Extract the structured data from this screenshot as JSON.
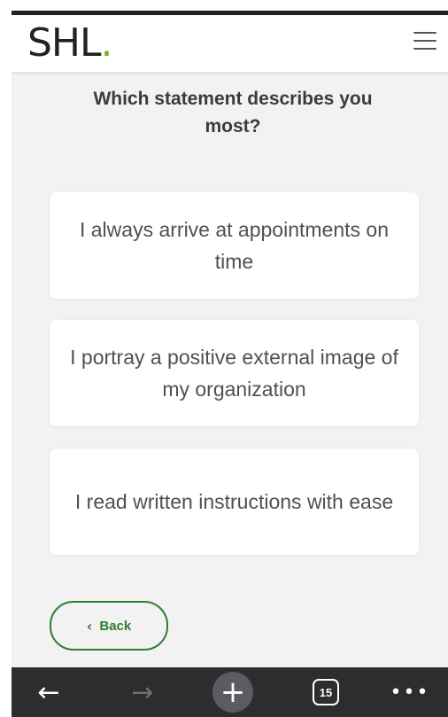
{
  "header": {
    "logo_text": "SHL",
    "logo_dot": ".",
    "menu_icon": "hamburger-menu-icon"
  },
  "question": "Which statement describes you most?",
  "options": [
    {
      "label": "I always arrive at appointments on time"
    },
    {
      "label": "I portray a positive external image of my organization"
    },
    {
      "label": "I read written instructions with ease"
    }
  ],
  "back_button": {
    "chevron": "‹",
    "label": "Back"
  },
  "browser_toolbar": {
    "back_icon": "arrow-left-icon",
    "forward_icon": "arrow-right-icon",
    "new_tab_icon": "plus-icon",
    "tab_count": "15",
    "more_icon": "more-dots-icon"
  },
  "colors": {
    "brand_green": "#74b32b",
    "button_green": "#2e7d32",
    "page_background": "#f2f2f2",
    "toolbar_background": "#2b2d2f"
  }
}
